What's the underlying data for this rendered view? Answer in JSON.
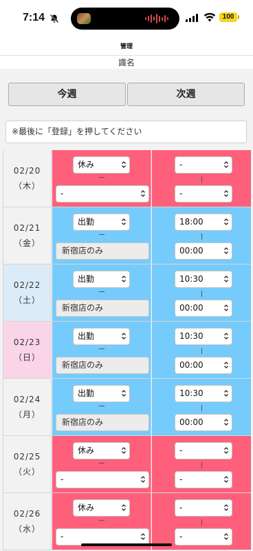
{
  "status_bar": {
    "time": "7:14",
    "battery": "100"
  },
  "header": {
    "title": "管理",
    "subtitle": "識名"
  },
  "week_nav": {
    "prev_label": "今週",
    "next_label": "次週"
  },
  "notice": "※最後に「登録」を押してください",
  "colors": {
    "off": "#fe5f7a",
    "work": "#75cbfb",
    "saturday": "#dcebf8",
    "sunday": "#fad5e8"
  },
  "rows": [
    {
      "date": "02/20",
      "weekday": "（木）",
      "status": "休み",
      "store": "-",
      "start": "-",
      "end": "-"
    },
    {
      "date": "02/21",
      "weekday": "（金）",
      "status": "出勤",
      "store": "新宿店のみ",
      "start": "18:00",
      "end": "00:00"
    },
    {
      "date": "02/22",
      "weekday": "（土）",
      "status": "出勤",
      "store": "新宿店のみ",
      "start": "10:30",
      "end": "00:00"
    },
    {
      "date": "02/23",
      "weekday": "（日）",
      "status": "出勤",
      "store": "新宿店のみ",
      "start": "10:30",
      "end": "00:00"
    },
    {
      "date": "02/24",
      "weekday": "（月）",
      "status": "出勤",
      "store": "新宿店のみ",
      "start": "10:30",
      "end": "00:00"
    },
    {
      "date": "02/25",
      "weekday": "（火）",
      "status": "休み",
      "store": "-",
      "start": "-",
      "end": "-"
    },
    {
      "date": "02/26",
      "weekday": "（水）",
      "status": "休み",
      "store": "-",
      "start": "-",
      "end": "-"
    }
  ]
}
